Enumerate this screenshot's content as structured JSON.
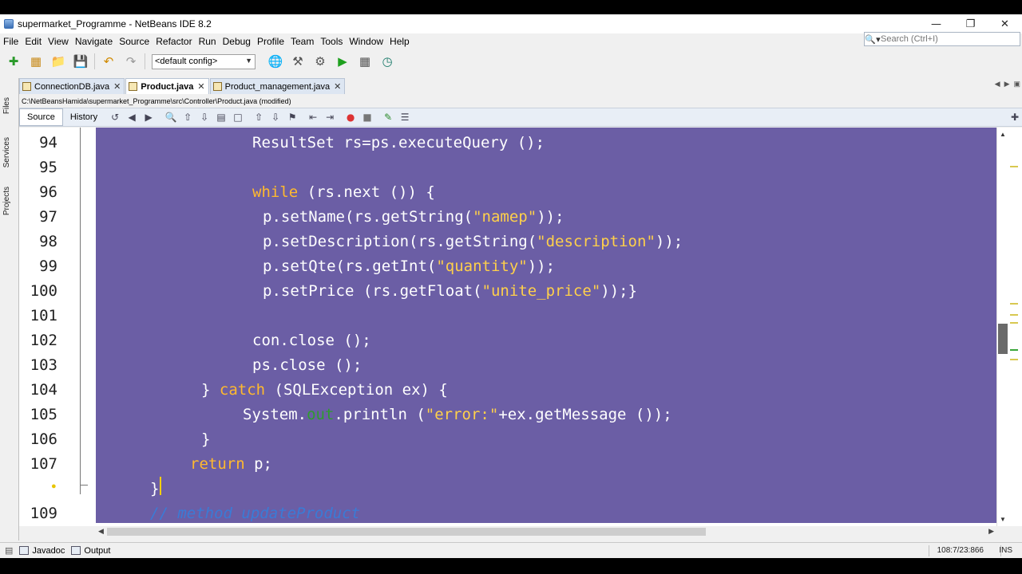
{
  "window": {
    "title": "supermarket_Programme - NetBeans IDE 8.2",
    "minimize": "—",
    "restore": "❐",
    "close": "✕"
  },
  "menu": [
    "File",
    "Edit",
    "View",
    "Navigate",
    "Source",
    "Refactor",
    "Run",
    "Debug",
    "Profile",
    "Team",
    "Tools",
    "Window",
    "Help"
  ],
  "search": {
    "placeholder": "Search (Ctrl+I)"
  },
  "toolbar": {
    "config": "<default config>"
  },
  "side_panels": [
    "Files",
    "Services",
    "Projects"
  ],
  "tabs": [
    {
      "label": "ConnectionDB.java",
      "close": "✕",
      "active": false
    },
    {
      "label": "Product.java",
      "close": "✕",
      "active": true
    },
    {
      "label": "Product_management.java",
      "close": "✕",
      "active": false
    }
  ],
  "file_path": "C:\\NetBeansHamida\\supermarket_Programme\\src\\Controller\\Product.java (modified)",
  "editor_tabs": {
    "source": "Source",
    "history": "History"
  },
  "code": {
    "lines": [
      {
        "num": "94"
      },
      {
        "num": "95"
      },
      {
        "num": "96"
      },
      {
        "num": "97"
      },
      {
        "num": "98"
      },
      {
        "num": "99"
      },
      {
        "num": "100"
      },
      {
        "num": "101"
      },
      {
        "num": "102"
      },
      {
        "num": "103"
      },
      {
        "num": "104"
      },
      {
        "num": "105"
      },
      {
        "num": "106"
      },
      {
        "num": "107"
      },
      {
        "num": ""
      },
      {
        "num": "109"
      }
    ],
    "l94": "ResultSet rs=ps.executeQuery ();",
    "l96_kw": "while",
    "l96_rest": " (rs.next ()) {",
    "l97_a": "p.setName(rs.getString(",
    "l97_s": "\"namep\"",
    "l97_b": "));",
    "l98_a": "p.setDescription(rs.getString(",
    "l98_s": "\"description\"",
    "l98_b": "));",
    "l99_a": "p.setQte(rs.getInt(",
    "l99_s": "\"quantity\"",
    "l99_b": "));",
    "l100_a": "p.setPrice (rs.getFloat(",
    "l100_s": "\"unite_price\"",
    "l100_b": "));}",
    "l102": "con.close ();",
    "l103": "ps.close ();",
    "l104_a": "} ",
    "l104_kw": "catch",
    "l104_b": " (SQLException ex) {",
    "l105_a": "System.",
    "l105_f": "out",
    "l105_b": ".println (",
    "l105_s": "\"error:\"",
    "l105_c": "+ex.getMessage ());",
    "l106": "}",
    "l107_kw": "return",
    "l107_b": " p;",
    "l108": "}",
    "l109": "// method updateProduct"
  },
  "status": {
    "javadoc": "Javadoc",
    "output": "Output",
    "position": "108:7/23:866",
    "mode": "INS"
  },
  "colors": {
    "selection": "#6b5ea5",
    "keyword": "#ffb92e",
    "string": "#ffd04a",
    "comment": "#3a7bd6"
  }
}
